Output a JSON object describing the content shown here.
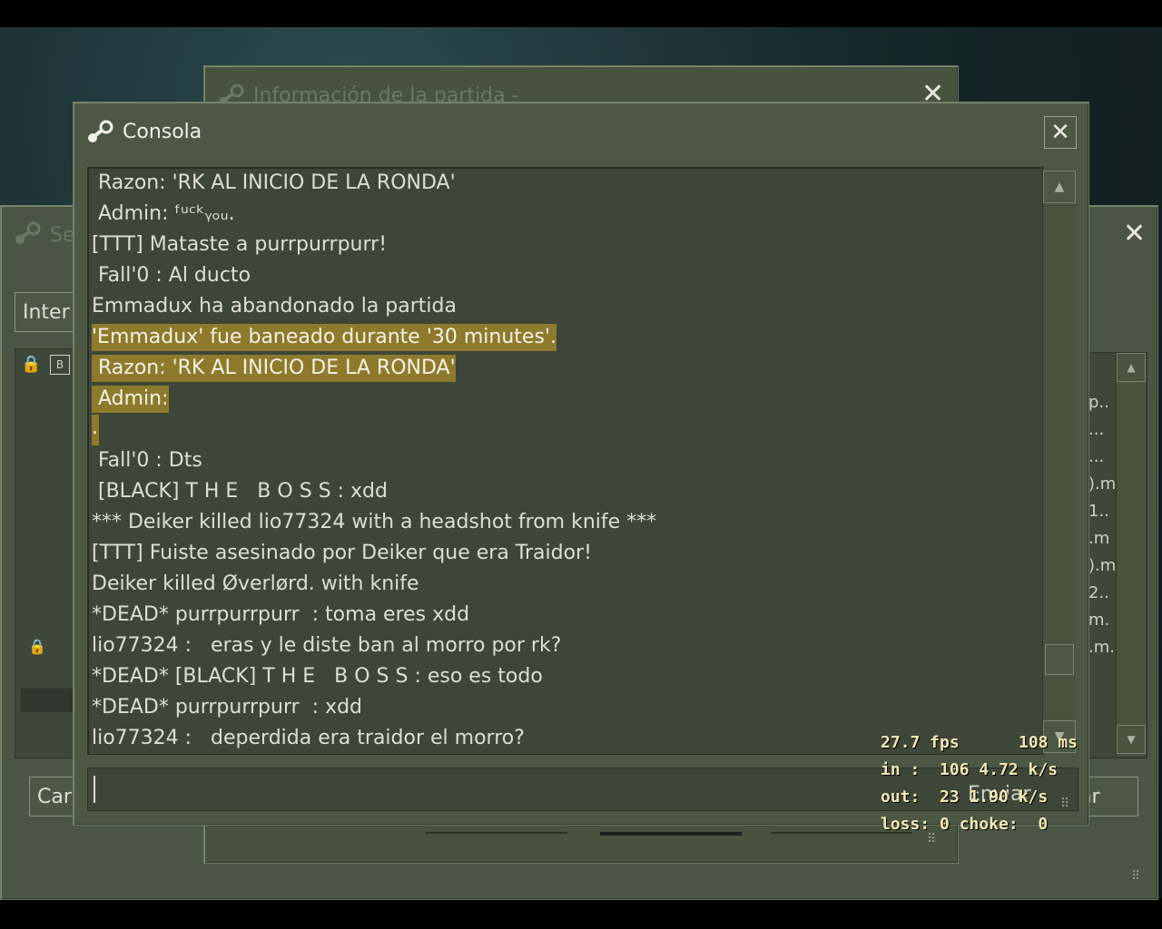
{
  "back_window": {
    "title": "Se",
    "tab": "Inter",
    "cancel": "Car",
    "right_button": "ar"
  },
  "mid_window": {
    "title": "Información de la partida -"
  },
  "console": {
    "title": "Consola",
    "lines": [
      " Razon: 'RK AL INICIO DE LA RONDA'",
      " Admin: ᶠᵘᶜᵏᵧₒᵤ.",
      "[TTT] Mataste a purrpurrpurr!",
      " Fall'0 : Al ducto",
      "Emmadux ha abandonado la partida",
      "'Emmadux' fue baneado durante '30 minutes'.",
      " Razon: 'RK AL INICIO DE LA RONDA'",
      " Admin:",
      ".",
      " Fall'0 : Dts",
      " [BLACK] T H E   B O S S : xdd",
      "*** Deiker killed lio77324 with a headshot from knife ***",
      "[TTT] Fuiste asesinado por Deiker que era Traidor!",
      "Deiker killed Øverlørd. with knife",
      "*DEAD* purrpurrpurr  : toma eres xdd",
      "lio77324 :   eras y le diste ban al morro por rk?",
      "*DEAD* [BLACK] T H E   B O S S : eso es todo",
      "*DEAD* purrpurrpurr  : xdd",
      "lio77324 :   deperdida era traidor el morro?"
    ],
    "input_value": "",
    "send_label": "Enviar"
  },
  "right_list": [
    "p..",
    "...",
    "...",
    ").m",
    "1..",
    ".m",
    ").m",
    "2..",
    "m.",
    ".m."
  ],
  "net_graph": {
    "fps": "27.7 fps",
    "ms": "108 ms",
    "in": "in :  106 4.72 k/s",
    "out": "out:  23 1.90 k/s",
    "loss": "loss: 0 choke:  0"
  },
  "colors": {
    "window": "#4c5844",
    "highlight": "#8e7a2c",
    "text": "#dedfd4"
  }
}
